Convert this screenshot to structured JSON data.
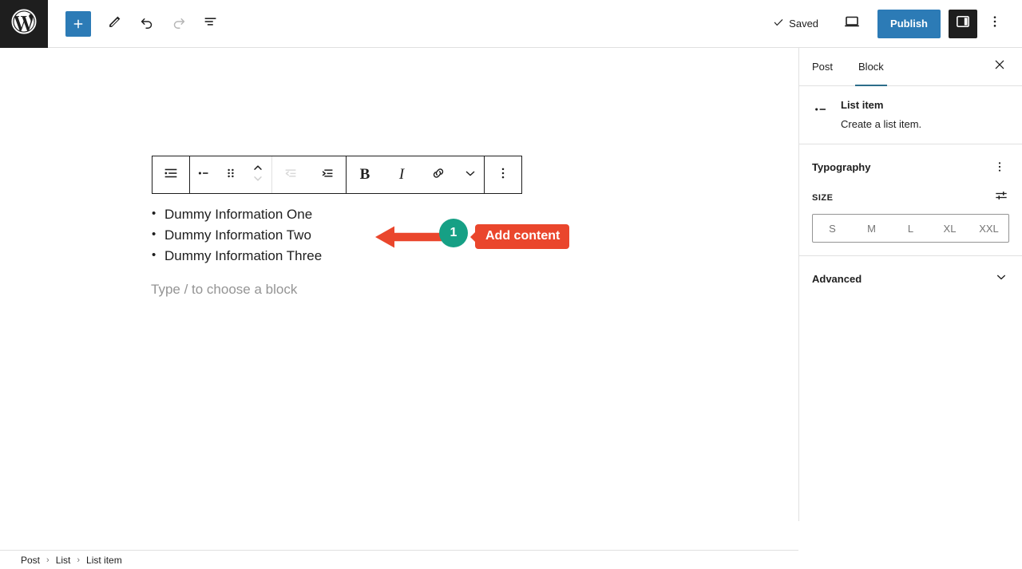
{
  "topbar": {
    "logo_icon": "wordpress-logo-icon",
    "add_block_icon": "plus-icon",
    "tools_icon": "pencil-edit-icon",
    "undo_icon": "undo-arrow-icon",
    "redo_icon": "redo-arrow-icon",
    "list_view_icon": "document-outline-icon",
    "saved_label": "Saved",
    "saved_check_icon": "checkmark-icon",
    "preview_icon": "laptop-preview-icon",
    "publish_label": "Publish",
    "sidebar_toggle_icon": "settings-panel-icon",
    "more_menu_icon": "vertical-ellipsis-icon"
  },
  "block_toolbar": {
    "items": [
      {
        "name": "block-type-list",
        "icon": "list-block-icon",
        "disabled": false
      },
      {
        "name": "drag-list-bullet",
        "icon": "list-bullet-dash-icon",
        "disabled": false
      },
      {
        "name": "drag-handle",
        "icon": "drag-dots-icon",
        "disabled": false
      },
      {
        "name": "move-up-down",
        "icon": "chevron-up-down-icon",
        "disabled": false
      },
      {
        "name": "outdent",
        "icon": "outdent-icon",
        "disabled": true
      },
      {
        "name": "indent",
        "icon": "indent-icon",
        "disabled": false
      },
      {
        "name": "bold",
        "icon": "bold-b-icon",
        "label": "B",
        "disabled": false
      },
      {
        "name": "italic",
        "icon": "italic-i-icon",
        "label": "I",
        "disabled": false
      },
      {
        "name": "link",
        "icon": "link-chain-icon",
        "disabled": false
      },
      {
        "name": "more-rich-text",
        "icon": "chevron-down-icon",
        "disabled": false
      },
      {
        "name": "block-options",
        "icon": "vertical-ellipsis-icon",
        "disabled": false
      }
    ]
  },
  "editor": {
    "list_items": [
      "Dummy Information One",
      "Dummy Information Two",
      "Dummy Information Three"
    ],
    "empty_paragraph_placeholder": "Type / to choose a block"
  },
  "annotation": {
    "step_number": "1",
    "label": "Add content",
    "arrow_color": "#ea462c",
    "badge_color": "#16a085",
    "label_color": "#ea462c",
    "arrow_icon": "left-arrow-icon"
  },
  "inspector": {
    "tabs": [
      {
        "label": "Post",
        "active": false
      },
      {
        "label": "Block",
        "active": true
      }
    ],
    "close_icon": "close-x-icon",
    "block_card": {
      "icon": "list-item-bullet-icon",
      "title": "List item",
      "description": "Create a list item."
    },
    "typography": {
      "title": "Typography",
      "kebab_icon": "vertical-ellipsis-icon",
      "size_label": "SIZE",
      "size_settings_icon": "sliders-settings-icon",
      "size_options": [
        "S",
        "M",
        "L",
        "XL",
        "XXL"
      ]
    },
    "advanced": {
      "title": "Advanced",
      "chevron_icon": "chevron-down-icon"
    }
  },
  "breadcrumb": {
    "items": [
      "Post",
      "List",
      "List item"
    ],
    "separator": "›"
  },
  "colors": {
    "accent_blue": "#2c7bb6",
    "canvas_bg": "#f0f0f0",
    "dark": "#1e1e1e",
    "tab_underline": "#2c6d8a"
  }
}
